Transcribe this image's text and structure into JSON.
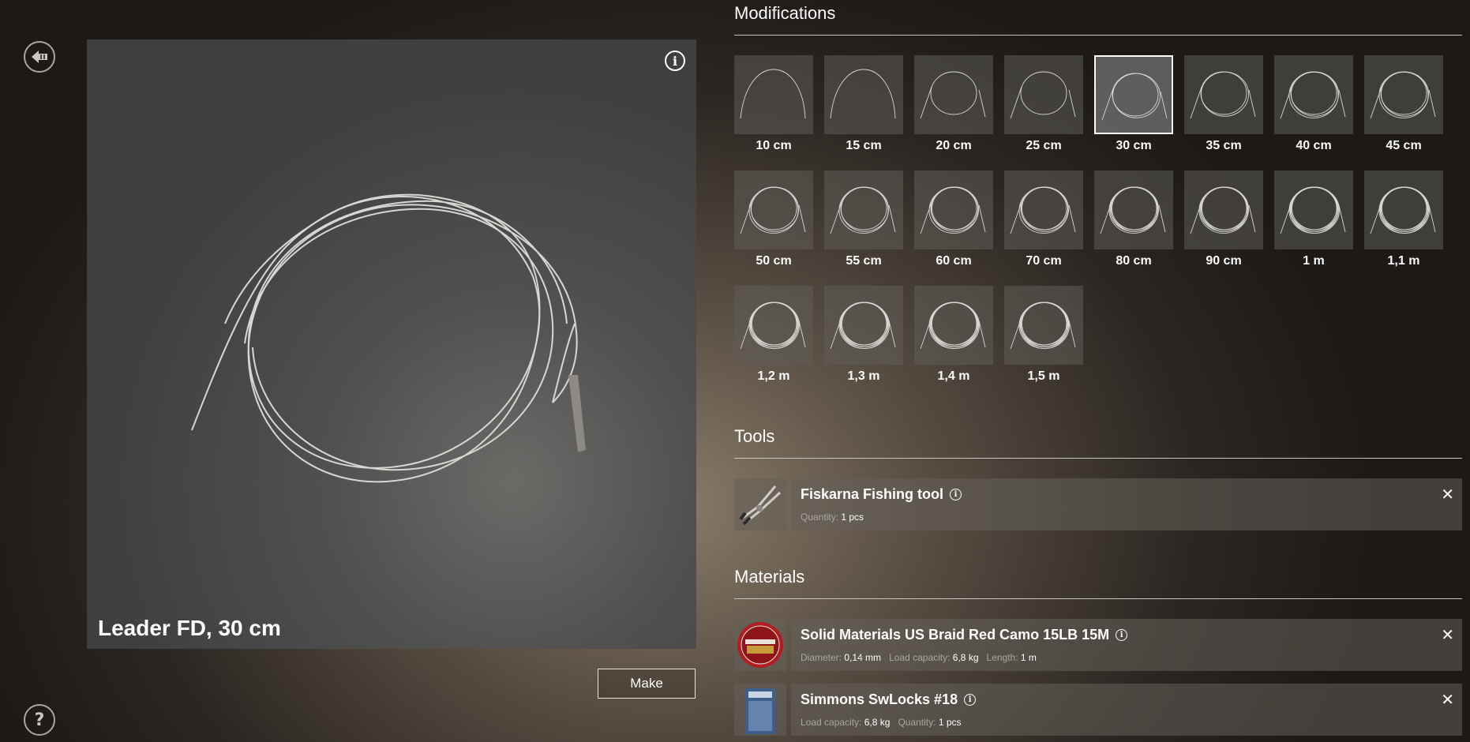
{
  "item_title": "Leader FD, 30 cm",
  "make_label": "Make",
  "sections": {
    "modifications": "Modifications",
    "tools": "Tools",
    "materials": "Materials"
  },
  "modifications": [
    {
      "label": "10 cm",
      "loops": 0
    },
    {
      "label": "15 cm",
      "loops": 0
    },
    {
      "label": "20 cm",
      "loops": 1
    },
    {
      "label": "25 cm",
      "loops": 1
    },
    {
      "label": "30 cm",
      "loops": 2,
      "selected": true
    },
    {
      "label": "35 cm",
      "loops": 2
    },
    {
      "label": "40 cm",
      "loops": 3
    },
    {
      "label": "45 cm",
      "loops": 3
    },
    {
      "label": "50 cm",
      "loops": 3
    },
    {
      "label": "55 cm",
      "loops": 3
    },
    {
      "label": "60 cm",
      "loops": 4
    },
    {
      "label": "70 cm",
      "loops": 4
    },
    {
      "label": "80 cm",
      "loops": 5
    },
    {
      "label": "90 cm",
      "loops": 5
    },
    {
      "label": "1 m",
      "loops": 6
    },
    {
      "label": "1,1 m",
      "loops": 6
    },
    {
      "label": "1,2 m",
      "loops": 7
    },
    {
      "label": "1,3 m",
      "loops": 7
    },
    {
      "label": "1,4 m",
      "loops": 8
    },
    {
      "label": "1,5 m",
      "loops": 8
    }
  ],
  "tools": [
    {
      "name": "Fiskarna Fishing tool",
      "icon": "pliers-icon",
      "meta": [
        {
          "k": "Quantity:",
          "v": "1 pcs"
        }
      ]
    }
  ],
  "materials": [
    {
      "name": "Solid Materials US Braid Red Camo 15LB 15M",
      "icon": "braid-spool-icon",
      "meta": [
        {
          "k": "Diameter:",
          "v": "0,14 mm"
        },
        {
          "k": "Load capacity:",
          "v": "6,8 kg"
        },
        {
          "k": "Length:",
          "v": "1 m"
        }
      ]
    },
    {
      "name": "Simmons SwLocks #18",
      "icon": "swivel-pack-icon",
      "meta": [
        {
          "k": "Load capacity:",
          "v": "6,8 kg"
        },
        {
          "k": "Quantity:",
          "v": "1 pcs"
        }
      ]
    }
  ],
  "icons": {
    "back": "back-arrow-icon",
    "help": "question-icon",
    "info": "info-icon",
    "close": "close-icon"
  },
  "text": {
    "info_glyph": "i",
    "help_glyph": "?",
    "close_glyph": "✕"
  }
}
